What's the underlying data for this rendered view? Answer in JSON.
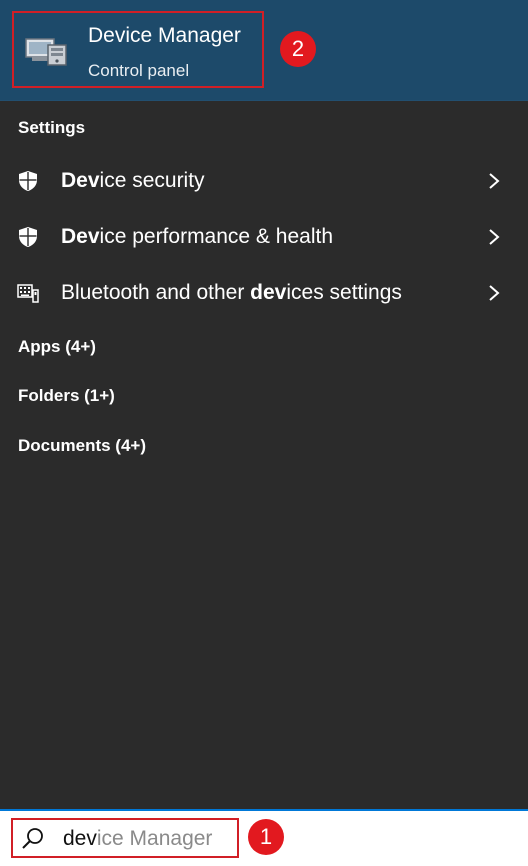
{
  "top_result": {
    "title_match": "Dev",
    "title_rest": "ice Manager",
    "subtitle": "Control panel",
    "icon": "device-manager-icon"
  },
  "markers": {
    "search": "1",
    "top_result": "2"
  },
  "sections": {
    "settings": "Settings",
    "apps": "Apps (4+)",
    "folders": "Folders (1+)",
    "documents": "Documents (4+)"
  },
  "settings_items": [
    {
      "match": "Dev",
      "rest": "ice security",
      "icon": "shield-icon"
    },
    {
      "match": "Dev",
      "rest": "ice performance & health",
      "icon": "shield-icon"
    },
    {
      "prefix": "Bluetooth and other ",
      "match": "dev",
      "rest": "ices settings",
      "icon": "keyboard-device-icon"
    }
  ],
  "search": {
    "typed": "dev",
    "suggestion": "ice Manager"
  },
  "colors": {
    "top_result_bg": "#1d4a6a",
    "panel_bg": "#2b2b2b",
    "highlight_red": "#d11f26",
    "search_focus": "#0078d7"
  }
}
